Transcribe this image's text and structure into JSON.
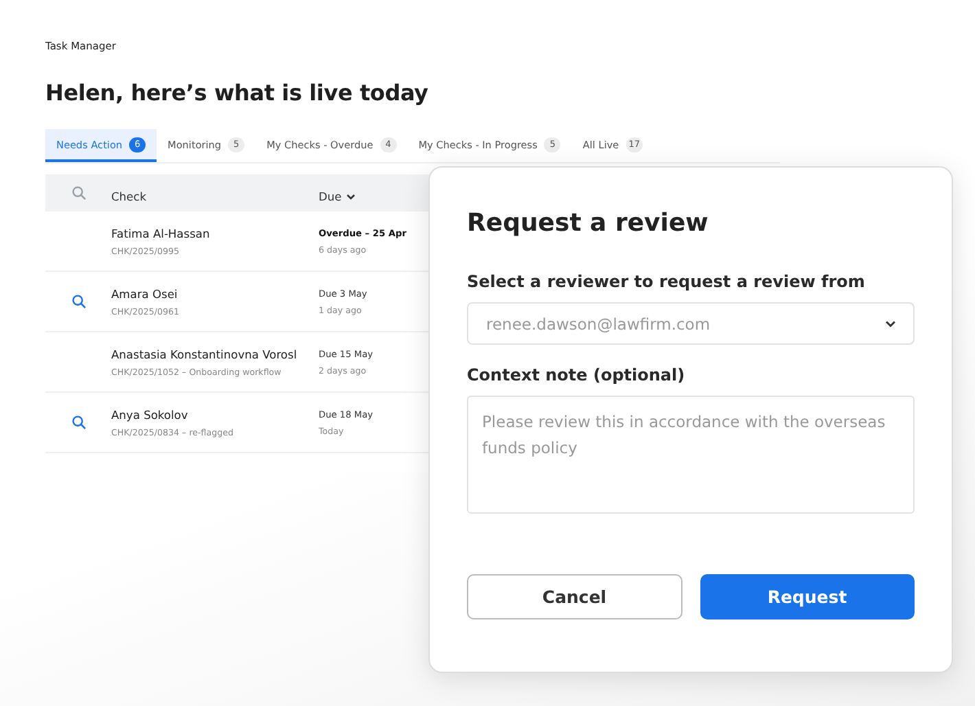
{
  "app_title": "Task Manager",
  "heading": "Helen, here’s what is live today",
  "tabs": [
    {
      "label": "Needs Action",
      "count": "6",
      "selected": true
    },
    {
      "label": "Monitoring",
      "count": "5",
      "selected": false
    },
    {
      "label": "My Checks - Overdue",
      "count": "4",
      "selected": false
    },
    {
      "label": "My Checks - In Progress",
      "count": "5",
      "selected": false
    },
    {
      "label": "All Live",
      "count": "17",
      "selected": false
    }
  ],
  "table": {
    "columns": [
      "Check",
      "Due"
    ],
    "rows": [
      {
        "name": "Fatima Al-Hassan",
        "ref": "CHK/2025/0995",
        "due": "Overdue – 25 Apr",
        "ago": "6 days ago",
        "flagged": false,
        "overdue": true
      },
      {
        "name": "Amara Osei",
        "ref": "CHK/2025/0961",
        "due": "Due 3 May",
        "ago": "1 day ago",
        "flagged": true,
        "overdue": false
      },
      {
        "name": "Anastasia Konstantinovna Vorosl",
        "ref": "CHK/2025/1052 – Onboarding workflow",
        "due": "Due 15 May",
        "ago": "2 days ago",
        "flagged": false,
        "overdue": false
      },
      {
        "name": "Anya Sokolov",
        "ref": "CHK/2025/0834 – re-flagged",
        "due": "Due 18 May",
        "ago": "Today",
        "flagged": true,
        "overdue": false
      }
    ]
  },
  "dialog": {
    "title": "Request a review",
    "reviewer_label": "Select a reviewer to request a review from",
    "reviewer": {
      "placeholder": "renee.dawson@lawfirm.com"
    },
    "note_label": "Context note (optional)",
    "note": {
      "placeholder": "Please review this in accordance with the overseas funds policy"
    },
    "buttons": [
      "Cancel",
      "Request"
    ]
  }
}
